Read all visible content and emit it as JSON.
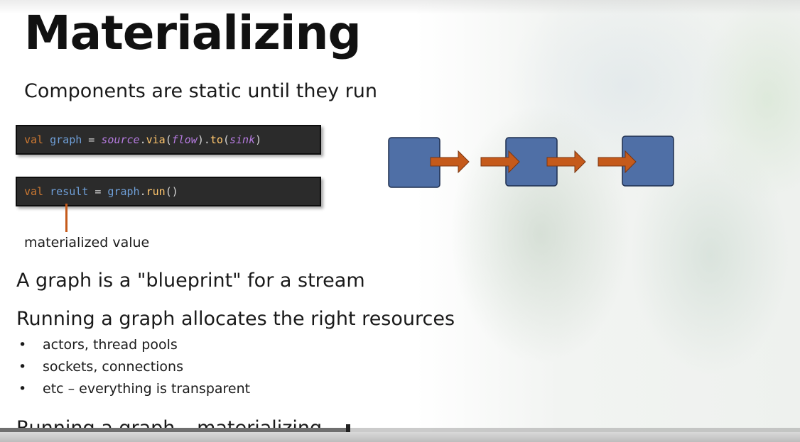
{
  "slide": {
    "title": "Materializing",
    "subtitle": "Components are static until they run",
    "code_line_1": {
      "kw": "val",
      "name": "graph",
      "eq": " = ",
      "source": "source",
      "dot1": ".",
      "via": "via",
      "paren_open": "(",
      "flow": "flow",
      "paren_close_dot": ").",
      "to": "to",
      "paren_open2": "(",
      "sink": "sink",
      "paren_close2": ")"
    },
    "code_line_2": {
      "kw": "val",
      "name": "result",
      "eq": " = ",
      "graph": "graph",
      "dot": ".",
      "run": "run",
      "parens": "()"
    },
    "annotation": "materialized value",
    "para_1": "A graph is a \"blueprint\" for a stream",
    "para_2": "Running a graph allocates the right resources",
    "bullets": [
      "actors, thread pools",
      "sockets, connections",
      "etc – everything is transparent"
    ],
    "bullet_marker": "•",
    "cut_line": {
      "prefix": "Running a graph – ",
      "underlined": "materializing"
    }
  },
  "colors": {
    "box_fill": "#4f6fa6",
    "box_stroke": "#1f2f4f",
    "arrow_fill": "#c55a1b",
    "arrow_stroke": "#7a3510"
  },
  "player": {
    "progress": 0.435
  }
}
